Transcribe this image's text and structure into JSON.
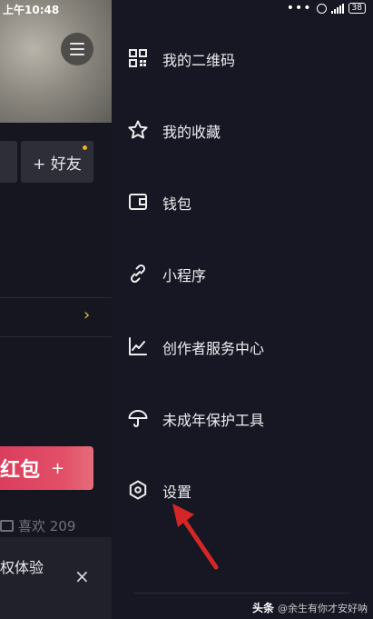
{
  "status_bar": {
    "time": "上午10:48",
    "battery": "38"
  },
  "profile": {
    "add_friend_label": "+ 好友",
    "chevron": "›",
    "hongbao_text": "红包",
    "hongbao_sparkle": "+",
    "likes_text": "喜欢 209",
    "tip_text": "权体验",
    "close_symbol": "×"
  },
  "drawer": {
    "items": [
      {
        "label": "我的二维码",
        "icon": "qr-code-icon"
      },
      {
        "label": "我的收藏",
        "icon": "star-icon"
      },
      {
        "label": "钱包",
        "icon": "wallet-icon"
      },
      {
        "label": "小程序",
        "icon": "link-icon"
      },
      {
        "label": "创作者服务中心",
        "icon": "chart-icon"
      },
      {
        "label": "未成年保护工具",
        "icon": "umbrella-icon"
      },
      {
        "label": "设置",
        "icon": "settings-icon"
      }
    ]
  },
  "watermark": {
    "brand": "头条",
    "handle": "@余生有你才安好呐"
  },
  "colors": {
    "accent": "#e7b43b",
    "hongbao": "#d93c5b",
    "arrow": "#d42626"
  }
}
